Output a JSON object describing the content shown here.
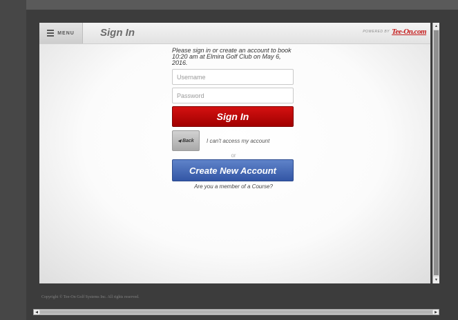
{
  "header": {
    "menu_label": "MENU",
    "page_title": "Sign In",
    "powered_by": "POWERED BY",
    "logo_text": "Tee-On.com"
  },
  "form": {
    "intro": "Please sign in or create an account to book 10:20 am at Elmira Golf Club on May 6, 2016.",
    "username_placeholder": "Username",
    "password_placeholder": "Password",
    "signin_label": "Sign In",
    "back_label": "Back",
    "cant_access": "I can't access my account",
    "or_text": "or",
    "create_label": "Create New Account",
    "member_text": "Are you a member of a Course?"
  },
  "footer": {
    "copyright": "Copyright © Tee-On Golf Systems Inc. All rights reserved."
  },
  "icons": {
    "menu": "hamburger-icon",
    "back": "left-arrow-icon",
    "scroll_up": "up-arrow-icon",
    "scroll_down": "down-arrow-icon"
  },
  "colors": {
    "sign_in_button": "#c00000",
    "create_account_button": "#4468b8",
    "logo": "#c41a1a"
  }
}
